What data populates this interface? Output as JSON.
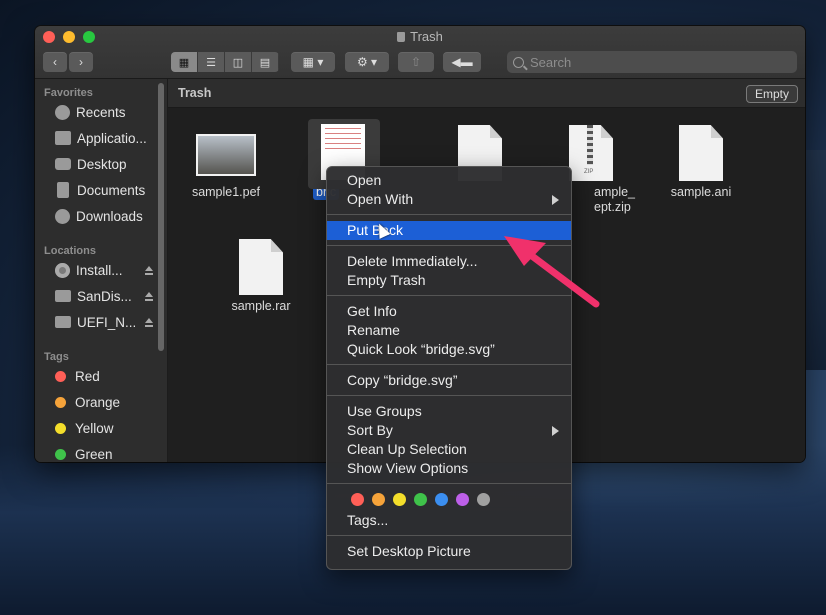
{
  "window": {
    "title": "Trash"
  },
  "toolbar": {
    "back_icon": "chevron-left",
    "forward_icon": "chevron-right",
    "views": [
      "icon-view",
      "list-view",
      "column-view",
      "gallery-view"
    ],
    "search_placeholder": "Search"
  },
  "sidebar": {
    "favorites_header": "Favorites",
    "favorites": [
      {
        "label": "Recents",
        "icon": "clock-icon"
      },
      {
        "label": "Applicatio...",
        "icon": "applications-icon"
      },
      {
        "label": "Desktop",
        "icon": "desktop-icon"
      },
      {
        "label": "Documents",
        "icon": "document-icon"
      },
      {
        "label": "Downloads",
        "icon": "download-icon"
      }
    ],
    "locations_header": "Locations",
    "locations": [
      {
        "label": "Install...",
        "icon": "disk-icon"
      },
      {
        "label": "SanDis...",
        "icon": "drive-icon"
      },
      {
        "label": "UEFI_N...",
        "icon": "drive-icon"
      }
    ],
    "tags_header": "Tags",
    "tags": [
      {
        "label": "Red",
        "color": "#ff5f57"
      },
      {
        "label": "Orange",
        "color": "#f6a33a"
      },
      {
        "label": "Yellow",
        "color": "#f4de2b"
      },
      {
        "label": "Green",
        "color": "#3fc24a"
      }
    ]
  },
  "content": {
    "path_title": "Trash",
    "empty_label": "Empty",
    "files": [
      {
        "name": "sample1.pef"
      },
      {
        "name": "bridge.svg",
        "visible_label": "bric"
      },
      {
        "name": "sample_...t.zip"
      },
      {
        "name": "sample.ani"
      },
      {
        "name": "sample.rar"
      }
    ],
    "zip_label_line1": "ample_",
    "zip_label_line2": "ept.zip"
  },
  "context_menu": {
    "open": "Open",
    "open_with": "Open With",
    "put_back": "Put Back",
    "delete_immediately": "Delete Immediately...",
    "empty_trash": "Empty Trash",
    "get_info": "Get Info",
    "rename": "Rename",
    "quick_look": "Quick Look “bridge.svg”",
    "copy": "Copy “bridge.svg”",
    "use_groups": "Use Groups",
    "sort_by": "Sort By",
    "clean_up": "Clean Up Selection",
    "show_view_options": "Show View Options",
    "tag_colors": [
      "#ff5f57",
      "#f6a33a",
      "#f4de2b",
      "#3fc24a",
      "#3b8ef0",
      "#bd5fe8",
      "#a0a0a0"
    ],
    "tags": "Tags...",
    "set_desktop_picture": "Set Desktop Picture"
  },
  "annotation": {
    "arrow_color": "#f0316b"
  }
}
